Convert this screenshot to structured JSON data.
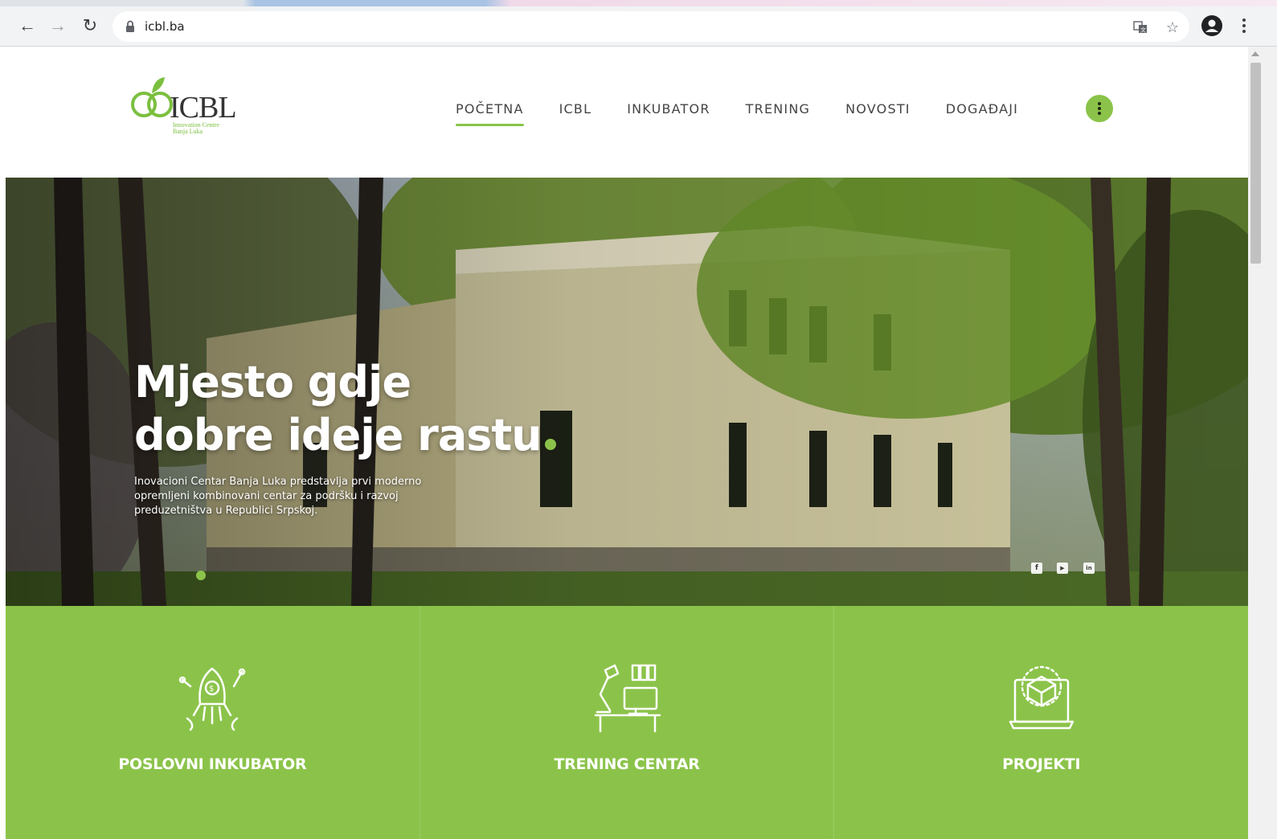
{
  "browser": {
    "url": "icbl.ba"
  },
  "site": {
    "logo_text": "ICBL",
    "logo_subtext": "Innovation Centre Banja Luka",
    "nav": [
      {
        "label": "POČETNA",
        "active": true
      },
      {
        "label": "ICBL",
        "active": false
      },
      {
        "label": "INKUBATOR",
        "active": false
      },
      {
        "label": "TRENING",
        "active": false
      },
      {
        "label": "NOVOSTI",
        "active": false
      },
      {
        "label": "DOGAĐAJI",
        "active": false
      }
    ],
    "accent_color": "#8bc34a"
  },
  "hero": {
    "title_line1": "Mjesto gdje",
    "title_line2": "dobre ideje rastu",
    "description": "Inovacioni Centar Banja Luka predstavlja prvi moderno opremljeni kombinovani centar za podršku i razvoj preduzetništva u Republici Srpskoj.",
    "social": [
      {
        "icon": "facebook-icon",
        "glyph": "f"
      },
      {
        "icon": "youtube-icon",
        "glyph": "▶"
      },
      {
        "icon": "linkedin-icon",
        "glyph": "in"
      }
    ]
  },
  "services": [
    {
      "label": "POSLOVNI INKUBATOR",
      "icon": "rocket-icon"
    },
    {
      "label": "TRENING CENTAR",
      "icon": "desk-lamp-icon"
    },
    {
      "label": "PROJEKTI",
      "icon": "laptop-cube-icon"
    }
  ]
}
